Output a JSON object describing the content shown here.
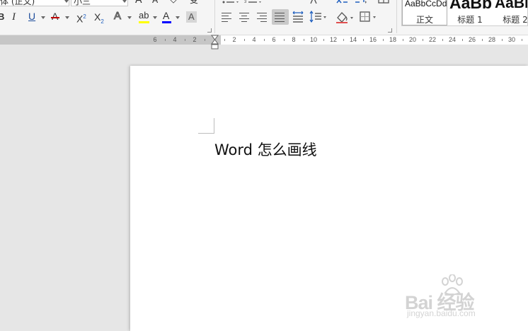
{
  "ribbon": {
    "font": {
      "font_name": "体 (正文)",
      "font_size": "小三",
      "bold_label": "B",
      "italic_label": "I",
      "underline_label": "U",
      "strike_label": "A",
      "super_label": "X",
      "super_mark": "2",
      "sub_label": "X",
      "sub_mark": "2",
      "effect_label": "A",
      "highlight_label": "ab",
      "fontcolor_label": "A",
      "shading_label": "A",
      "grow_label": "A",
      "shrink_label": "A",
      "clear_label": "◇",
      "phonetic_label": "变",
      "colors": {
        "strike": "#c00000",
        "highlight": "#ffff00",
        "fontcolor": "#0000ff",
        "super_mark": "#1f5fbf"
      }
    },
    "paragraph": {
      "active_alignment": "justify"
    },
    "styles": [
      {
        "sample": "AaBbCcDd",
        "name": "正文"
      },
      {
        "sample": "AaBb",
        "name": "标题 1"
      },
      {
        "sample": "AaBb",
        "name": "标题 2"
      }
    ]
  },
  "ruler": {
    "labels": [
      {
        "text": "6",
        "value": -6
      },
      {
        "text": "4",
        "value": -4
      },
      {
        "text": "2",
        "value": -2
      },
      {
        "text": "2",
        "value": 2
      },
      {
        "text": "4",
        "value": 4
      },
      {
        "text": "6",
        "value": 6
      },
      {
        "text": "8",
        "value": 8
      },
      {
        "text": "10",
        "value": 10
      },
      {
        "text": "12",
        "value": 12
      },
      {
        "text": "14",
        "value": 14
      },
      {
        "text": "16",
        "value": 16
      },
      {
        "text": "18",
        "value": 18
      },
      {
        "text": "20",
        "value": 20
      },
      {
        "text": "22",
        "value": 22
      },
      {
        "text": "24",
        "value": 24
      },
      {
        "text": "26",
        "value": 26
      },
      {
        "text": "28",
        "value": 28
      },
      {
        "text": "30",
        "value": 30
      }
    ]
  },
  "document": {
    "text": "Word 怎么画线"
  },
  "watermark": {
    "brand": "Bai 经验",
    "url": "jingyan.baidu.com"
  }
}
